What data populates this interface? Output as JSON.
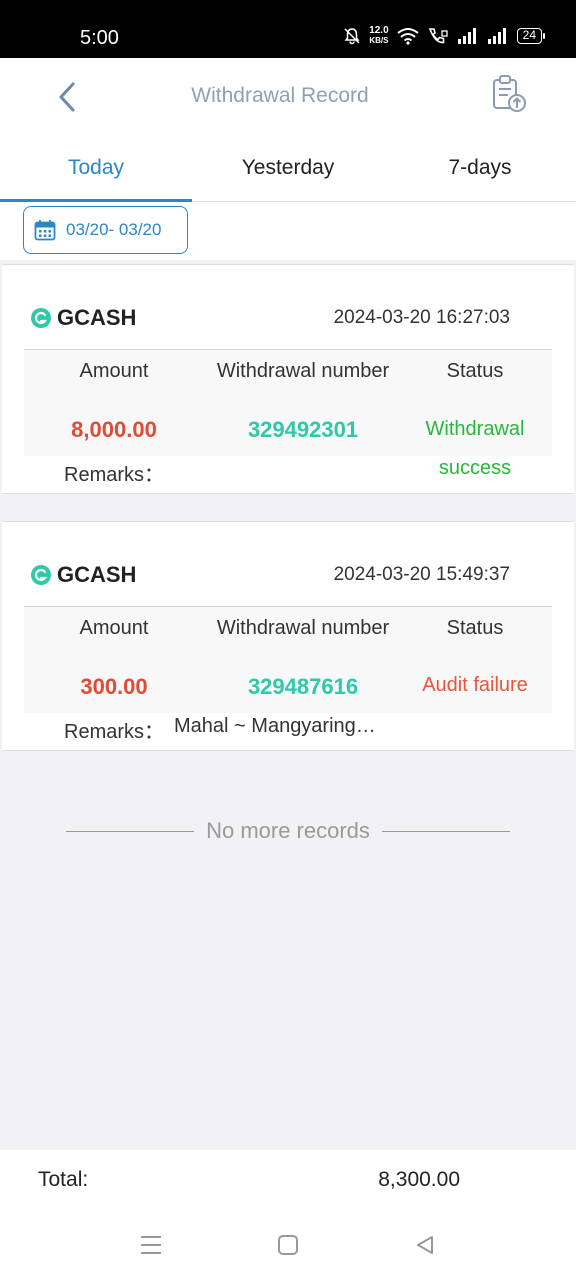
{
  "status_bar": {
    "time": "5:00",
    "speed_value": "12.0",
    "speed_unit": "KB/S",
    "battery": "24"
  },
  "header": {
    "title": "Withdrawal Record",
    "back_icon": "chevron-left-icon",
    "record_icon": "clipboard-upload-icon"
  },
  "tabs": [
    {
      "label": "Today",
      "active": true
    },
    {
      "label": "Yesterday",
      "active": false
    },
    {
      "label": "7-days",
      "active": false
    }
  ],
  "date_filter": {
    "label": "03/20- 03/20",
    "icon": "calendar-icon"
  },
  "records": [
    {
      "method": "GCASH",
      "time": "2024-03-20 16:27:03",
      "amount_label": "Amount",
      "number_label": "Withdrawal number",
      "status_label": "Status",
      "amount": "8,000.00",
      "number": "329492301",
      "status": "Withdrawal success",
      "remarks_label": "Remarks：",
      "remarks": ""
    },
    {
      "method": "GCASH",
      "time": "2024-03-20 15:49:37",
      "amount_label": "Amount",
      "number_label": "Withdrawal number",
      "status_label": "Status",
      "amount": "300.00",
      "number": "329487616",
      "status": "Audit failure",
      "remarks_label": "Remarks：",
      "remarks": "Mahal ~ Mangyaring…"
    }
  ],
  "footer": {
    "no_more": "No more records",
    "total_label": "Total:",
    "total_value": "8,300.00"
  },
  "colors": {
    "accent": "#2a88c7",
    "amount": "#e14b34",
    "number": "#2ec9a9",
    "success": "#27b83c",
    "failure": "#e8553c"
  }
}
